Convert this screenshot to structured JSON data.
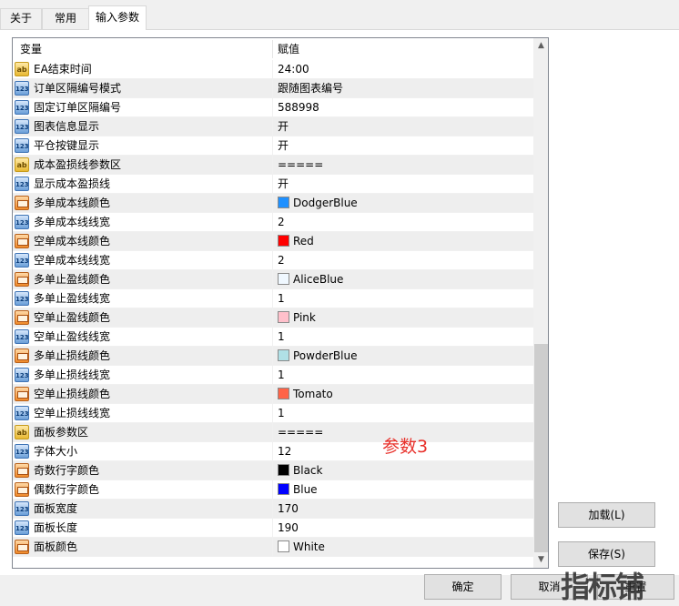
{
  "tabs": [
    {
      "label": "关于"
    },
    {
      "label": "常用"
    },
    {
      "label": "输入参数",
      "active": true
    }
  ],
  "grid": {
    "col_variable": "变量",
    "col_value": "赋值"
  },
  "rows": [
    {
      "icon": "ab",
      "name": "EA结束时间",
      "value": "24:00"
    },
    {
      "icon": "123",
      "name": "订单区隔编号模式",
      "value": "跟随图表编号"
    },
    {
      "icon": "123",
      "name": "固定订单区隔编号",
      "value": "588998"
    },
    {
      "icon": "123",
      "name": "图表信息显示",
      "value": "开"
    },
    {
      "icon": "123",
      "name": "平仓按键显示",
      "value": "开"
    },
    {
      "icon": "ab",
      "name": "成本盈损线参数区",
      "value": "====="
    },
    {
      "icon": "123",
      "name": "显示成本盈损线",
      "value": "开"
    },
    {
      "icon": "color",
      "name": "多单成本线颜色",
      "value": "DodgerBlue",
      "color": "#1e90ff"
    },
    {
      "icon": "123",
      "name": "多单成本线线宽",
      "value": "2"
    },
    {
      "icon": "color",
      "name": "空单成本线颜色",
      "value": "Red",
      "color": "#ff0000"
    },
    {
      "icon": "123",
      "name": "空单成本线线宽",
      "value": "2"
    },
    {
      "icon": "color",
      "name": "多单止盈线颜色",
      "value": "AliceBlue",
      "color": "#f0f8ff"
    },
    {
      "icon": "123",
      "name": "多单止盈线线宽",
      "value": "1"
    },
    {
      "icon": "color",
      "name": "空单止盈线颜色",
      "value": "Pink",
      "color": "#ffc0cb"
    },
    {
      "icon": "123",
      "name": "空单止盈线线宽",
      "value": "1"
    },
    {
      "icon": "color",
      "name": "多单止损线颜色",
      "value": "PowderBlue",
      "color": "#b0e0e6"
    },
    {
      "icon": "123",
      "name": "多单止损线线宽",
      "value": "1"
    },
    {
      "icon": "color",
      "name": "空单止损线颜色",
      "value": "Tomato",
      "color": "#ff6347"
    },
    {
      "icon": "123",
      "name": "空单止损线线宽",
      "value": "1"
    },
    {
      "icon": "ab",
      "name": "面板参数区",
      "value": "====="
    },
    {
      "icon": "123",
      "name": "字体大小",
      "value": "12"
    },
    {
      "icon": "color",
      "name": "奇数行字颜色",
      "value": "Black",
      "color": "#000000"
    },
    {
      "icon": "color",
      "name": "偶数行字颜色",
      "value": "Blue",
      "color": "#0000ff"
    },
    {
      "icon": "123",
      "name": "面板宽度",
      "value": "170"
    },
    {
      "icon": "123",
      "name": "面板长度",
      "value": "190"
    },
    {
      "icon": "color",
      "name": "面板颜色",
      "value": "White",
      "color": "#ffffff"
    }
  ],
  "annotation": "参数3",
  "buttons": {
    "load": "加载(L)",
    "save": "保存(S)",
    "ok": "确定",
    "cancel": "取消",
    "reset": "重置"
  },
  "watermark": "指标铺",
  "colors": {
    "annotation": "#e8302a",
    "alt_row": "#eeeeee"
  }
}
